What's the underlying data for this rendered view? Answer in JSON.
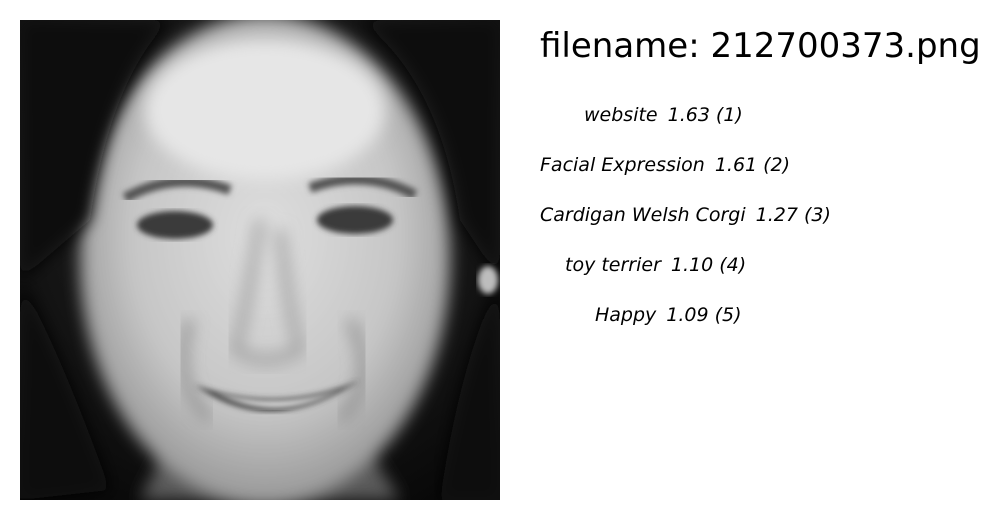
{
  "header": {
    "filename_label": "filename:",
    "filename": "212700373.png"
  },
  "predictions": [
    {
      "label": "website",
      "score": "1.63",
      "rank": "(1)"
    },
    {
      "label": "Facial Expression",
      "score": "1.61",
      "rank": "(2)"
    },
    {
      "label": "Cardigan Welsh Corgi",
      "score": "1.27",
      "rank": "(3)"
    },
    {
      "label": "toy terrier",
      "score": "1.10",
      "rank": "(4)"
    },
    {
      "label": "Happy",
      "score": "1.09",
      "rank": "(5)"
    }
  ]
}
